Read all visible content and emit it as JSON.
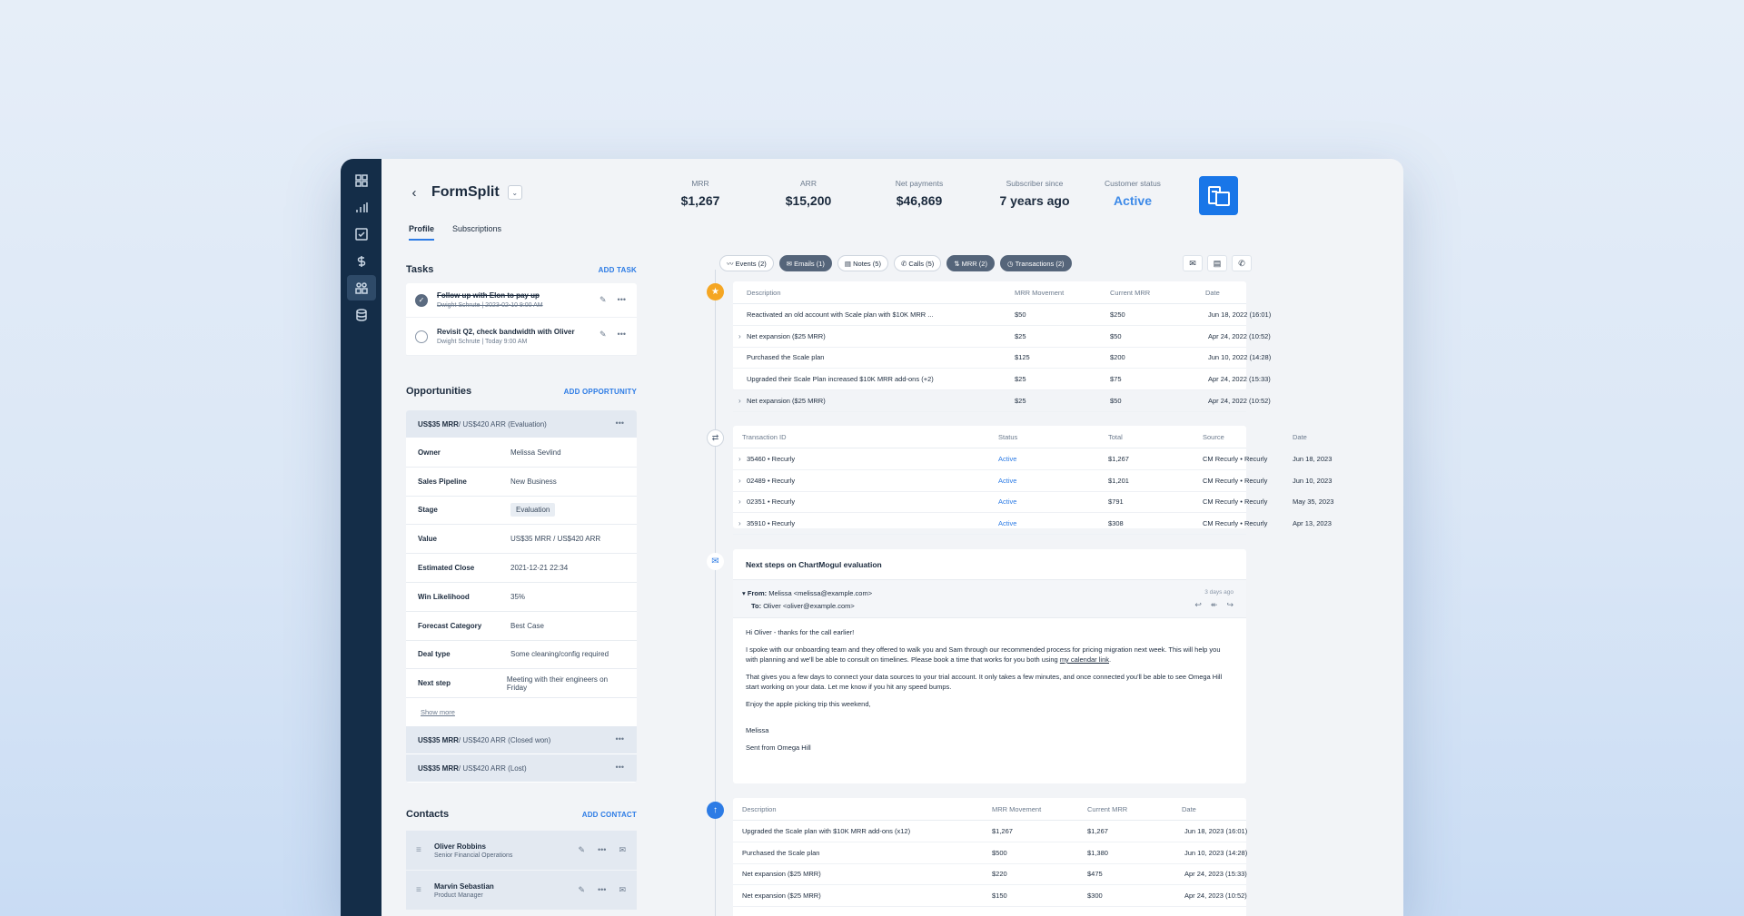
{
  "app": {
    "title": "FormSplit",
    "tabs": [
      "Profile",
      "Subscriptions"
    ]
  },
  "metrics": [
    {
      "label": "MRR",
      "value": "$1,267"
    },
    {
      "label": "ARR",
      "value": "$15,200"
    },
    {
      "label": "Net payments",
      "value": "$46,869"
    },
    {
      "label": "Subscriber since",
      "value": "7 years ago"
    },
    {
      "label": "Customer status",
      "value": "Active"
    }
  ],
  "tasks": {
    "title": "Tasks",
    "add": "ADD TASK",
    "items": [
      {
        "title": "Follow up with Elon to pay up",
        "meta": "Dwight Schrute  |  2023-02-10  9:00 AM",
        "done": true
      },
      {
        "title": "Revisit Q2, check bandwidth with Oliver",
        "meta": "Dwight Schrute  |  Today  9:00 AM",
        "done": false
      }
    ]
  },
  "opps": {
    "title": "Opportunities",
    "add": "ADD OPPORTUNITY",
    "head": {
      "bold": "US$35 MRR",
      "rest": " / US$420 ARR (Evaluation)"
    },
    "rows": [
      {
        "k": "Owner",
        "v": "Melissa Sevlind"
      },
      {
        "k": "Sales Pipeline",
        "v": "New Business"
      },
      {
        "k": "Stage",
        "v": "Evaluation"
      },
      {
        "k": "Value",
        "v": "US$35 MRR / US$420 ARR"
      },
      {
        "k": "Estimated Close",
        "v": "2021-12-21 22:34"
      },
      {
        "k": "Win Likelihood",
        "v": "35%"
      },
      {
        "k": "Forecast Category",
        "v": "Best Case"
      },
      {
        "k": "Deal type",
        "v": "Some cleaning/config required"
      },
      {
        "k": "Next step",
        "v": "Meeting with their engineers on Friday"
      }
    ],
    "show_more": "Show more",
    "others": [
      {
        "bold": "US$35 MRR",
        "rest": " / US$420 ARR (Closed won)"
      },
      {
        "bold": "US$35 MRR",
        "rest": " / US$420 ARR (Lost)"
      }
    ]
  },
  "contacts": {
    "title": "Contacts",
    "add": "ADD CONTACT",
    "items": [
      {
        "name": "Oliver Robbins",
        "role": "Senior Financial Operations"
      },
      {
        "name": "Marvin Sebastian",
        "role": "Product Manager"
      }
    ]
  },
  "filters": [
    "Events (2)",
    "Emails (1)",
    "Notes (5)",
    "Calls (5)",
    "MRR (2)",
    "Transactions (2)"
  ],
  "mrr1": {
    "headers": [
      "Description",
      "MRR Movement",
      "Current MRR",
      "Date"
    ],
    "rows": [
      {
        "d": "Reactivated an old account with Scale plan with $10K MRR ...",
        "m": "$50",
        "c": "$250",
        "t": "Jun 18, 2022 (16:01)",
        "exp": false
      },
      {
        "d": "Net expansion ($25 MRR)",
        "m": "$25",
        "c": "$50",
        "t": "Apr 24, 2022 (10:52)",
        "exp": true
      },
      {
        "d": "Purchased the Scale plan",
        "m": "$125",
        "c": "$200",
        "t": "Jun 10, 2022 (14:28)",
        "exp": false
      },
      {
        "d": "Upgraded their Scale Plan increased $10K MRR add-ons (+2)",
        "m": "$25",
        "c": "$75",
        "t": "Apr 24, 2022 (15:33)",
        "exp": false
      },
      {
        "d": "Net expansion ($25 MRR)",
        "m": "$25",
        "c": "$50",
        "t": "Apr 24, 2022 (10:52)",
        "exp": true
      }
    ]
  },
  "tx": {
    "headers": [
      "Transaction ID",
      "Status",
      "Total",
      "Source",
      "Date"
    ],
    "rows": [
      {
        "id": "35460 • Recurly",
        "s": "Active",
        "t": "$1,267",
        "src": "CM Recurly • Recurly",
        "d": "Jun 18, 2023"
      },
      {
        "id": "02489 • Recurly",
        "s": "Active",
        "t": "$1,201",
        "src": "CM Recurly • Recurly",
        "d": "Jun 10, 2023"
      },
      {
        "id": "02351 • Recurly",
        "s": "Active",
        "t": "$791",
        "src": "CM Recurly • Recurly",
        "d": "May 35, 2023"
      },
      {
        "id": "35910 • Recurly",
        "s": "Active",
        "t": "$308",
        "src": "CM Recurly • Recurly",
        "d": "Apr 13, 2023"
      }
    ]
  },
  "email": {
    "subject": "Next steps on ChartMogul evaluation",
    "from_label": "From:",
    "from": "Melissa <melissa@example.com>",
    "to_label": "To:",
    "to": "Oliver <oliver@example.com>",
    "time": "3 days ago",
    "greeting": "Hi Oliver - thanks for the call earlier!",
    "p1": "I spoke with our onboarding team and they offered to walk you and Sam through our recommended process for pricing migration next week. This will help you with planning and we'll be able to consult on timelines. Please book a time that works for you both using",
    "p1_link": "my calendar link",
    "p2": "That gives you a few days to connect your data sources to your trial account. It only takes a few minutes, and once connected you'll be able to see Omega Hill start working on your data. Let me know if you hit any speed bumps.",
    "p3": "Enjoy the apple picking trip this weekend,",
    "sign": "Melissa",
    "sent": "Sent from Omega Hill"
  },
  "mrr2": {
    "headers": [
      "Description",
      "MRR Movement",
      "Current MRR",
      "Date"
    ],
    "rows": [
      {
        "d": "Upgraded the Scale plan with $10K MRR add-ons (x12)",
        "m": "$1,267",
        "c": "$1,267",
        "t": "Jun 18, 2023 (16:01)"
      },
      {
        "d": "Purchased the Scale plan",
        "m": "$500",
        "c": "$1,380",
        "t": "Jun 10, 2023 (14:28)"
      },
      {
        "d": "Net expansion ($25 MRR)",
        "m": "$220",
        "c": "$475",
        "t": "Apr 24, 2023 (15:33)"
      },
      {
        "d": "Net expansion ($25 MRR)",
        "m": "$150",
        "c": "$300",
        "t": "Apr 24, 2023 (10:52)"
      }
    ]
  }
}
